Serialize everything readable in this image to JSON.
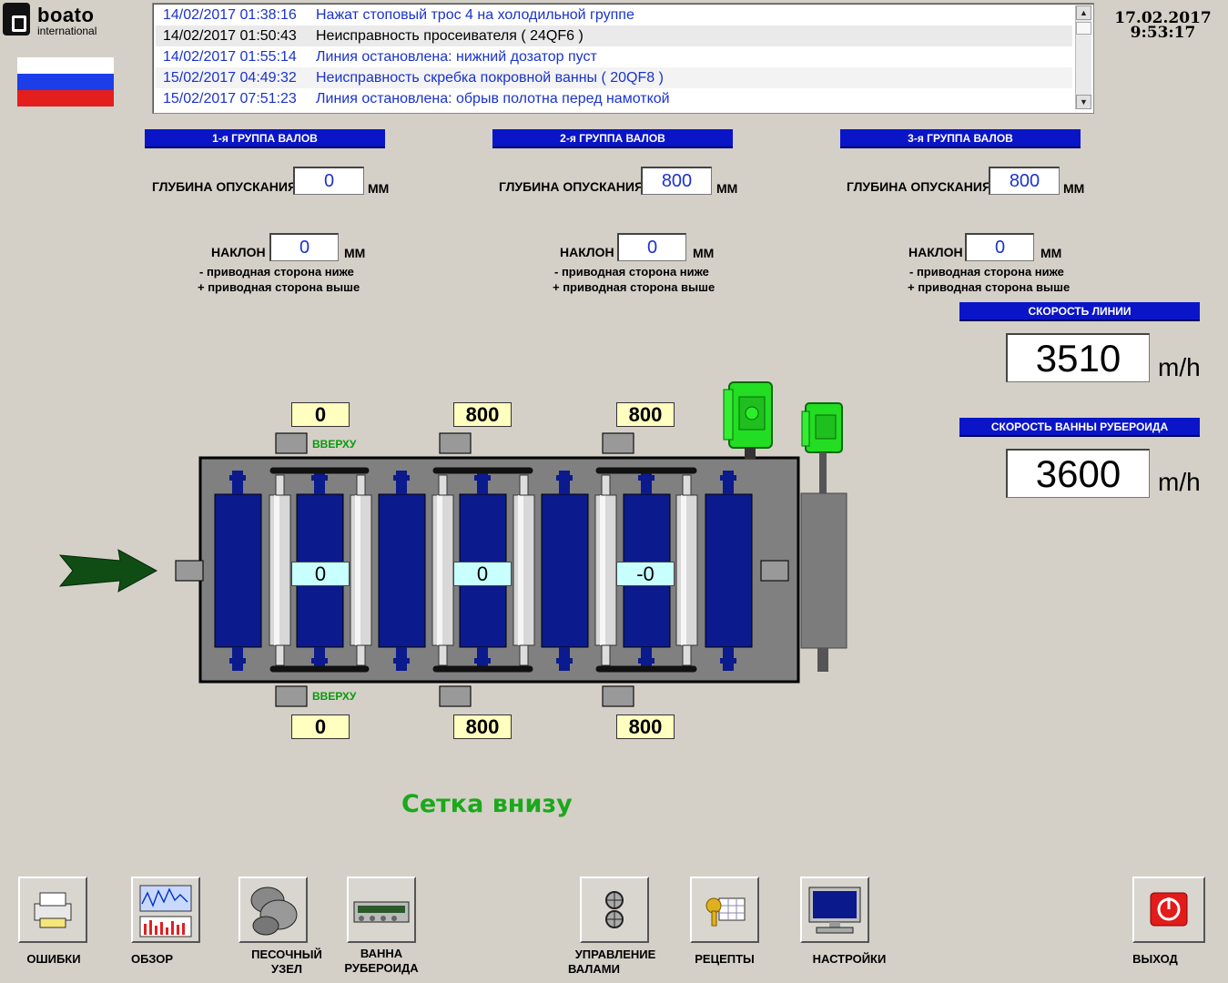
{
  "header": {
    "logo_main": "boato",
    "logo_sub": "international",
    "date": "17.02.2017",
    "time": "9:53:17"
  },
  "alarms": [
    {
      "time": "14/02/2017 01:38:16",
      "message": "Нажат стоповый трос 4 на холодильной группе",
      "color": "#1a33cc"
    },
    {
      "time": "14/02/2017 01:50:43",
      "message": "Неисправность просеивателя ( 24QF6 )",
      "color": "#000000"
    },
    {
      "time": "14/02/2017 01:55:14",
      "message": "Линия остановлена: нижний дозатор пуст",
      "color": "#1a33cc"
    },
    {
      "time": "15/02/2017 04:49:32",
      "message": "Неисправность скребка покровной ванны ( 20QF8 )",
      "color": "#1a33cc"
    },
    {
      "time": "15/02/2017 07:51:23",
      "message": "Линия остановлена: обрыв полотна перед намоткой",
      "color": "#1a33cc"
    }
  ],
  "groups": [
    {
      "title": "1-я ГРУППА ВАЛОВ",
      "depth_label": "ГЛУБИНА ОПУСКАНИЯ",
      "depth": "0",
      "depth_unit": "ММ",
      "tilt_label": "НАКЛОН",
      "tilt": "0",
      "tilt_unit": "ММ",
      "hint_minus": "- приводная сторона ниже",
      "hint_plus": "+ приводная сторона выше"
    },
    {
      "title": "2-я ГРУППА ВАЛОВ",
      "depth_label": "ГЛУБИНА ОПУСКАНИЯ",
      "depth": "800",
      "depth_unit": "ММ",
      "tilt_label": "НАКЛОН",
      "tilt": "0",
      "tilt_unit": "ММ",
      "hint_minus": "- приводная сторона ниже",
      "hint_plus": "+ приводная сторона выше"
    },
    {
      "title": "3-я ГРУППА ВАЛОВ",
      "depth_label": "ГЛУБИНА ОПУСКАНИЯ",
      "depth": "800",
      "depth_unit": "ММ",
      "tilt_label": "НАКЛОН",
      "tilt": "0",
      "tilt_unit": "ММ",
      "hint_minus": "- приводная сторона ниже",
      "hint_plus": "+ приводная сторона выше"
    }
  ],
  "line_speed": {
    "title": "СКОРОСТЬ ЛИНИИ",
    "value": "3510",
    "unit": "m/h"
  },
  "bath_speed": {
    "title": "СКОРОСТЬ ВАННЫ РУБЕРОИДА",
    "value": "3600",
    "unit": "m/h"
  },
  "diagram": {
    "top_values": [
      "0",
      "800",
      "800"
    ],
    "bottom_values": [
      "0",
      "800",
      "800"
    ],
    "center_values": [
      "0",
      "0",
      "-0"
    ],
    "up_label_top": "ВВЕРХУ",
    "up_label_bottom": "ВВЕРХУ",
    "motor_color": "#22dd22",
    "roller_color": "#0b1a8c"
  },
  "status_text": "Сетка внизу",
  "nav": {
    "errors": "ОШИБКИ",
    "overview": "ОБЗОР",
    "sand_line1": "ПЕСОЧНЫЙ",
    "sand_line2": "УЗЕЛ",
    "bath_line1": "ВАННА",
    "bath_line2": "РУБЕРОИДА",
    "rolls_line1": "УПРАВЛЕНИЕ",
    "rolls_line2": "ВАЛАМИ",
    "recipes": "РЕЦЕПТЫ",
    "settings": "НАСТРОЙКИ",
    "exit": "ВЫХОД"
  }
}
